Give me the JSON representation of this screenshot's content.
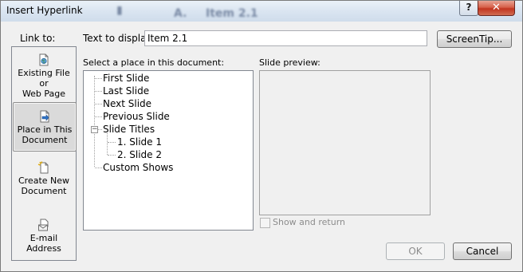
{
  "window": {
    "title": "Insert Hyperlink",
    "blurred_title_fragments": [
      "A.",
      "Item 2.1"
    ],
    "help_label": "?",
    "close_label": "✕"
  },
  "link_to": {
    "label": "Link to:",
    "items": [
      {
        "label_line1": "Existing File or",
        "label_line2": "Web Page",
        "icon": "existing-file-icon",
        "selected": false
      },
      {
        "label_line1": "Place in This",
        "label_line2": "Document",
        "icon": "place-in-document-icon",
        "selected": true
      },
      {
        "label_line1": "Create New",
        "label_line2": "Document",
        "icon": "new-document-icon",
        "selected": false
      },
      {
        "label_line1": "E-mail Address",
        "label_line2": "",
        "icon": "email-icon",
        "selected": false
      }
    ]
  },
  "text_to_display": {
    "label": "Text to display:",
    "value": "Item 2.1"
  },
  "screentip_button": "ScreenTip...",
  "place_list": {
    "label": "Select a place in this document:",
    "items": [
      {
        "text": "First Slide",
        "level": 0
      },
      {
        "text": "Last Slide",
        "level": 0
      },
      {
        "text": "Next Slide",
        "level": 0
      },
      {
        "text": "Previous Slide",
        "level": 0
      },
      {
        "text": "Slide Titles",
        "level": 0,
        "expanded": true,
        "expander": "−"
      },
      {
        "text": "1. Slide 1",
        "level": 1
      },
      {
        "text": "2. Slide 2",
        "level": 1
      },
      {
        "text": "Custom Shows",
        "level": 0
      }
    ]
  },
  "slide_preview": {
    "label": "Slide preview:"
  },
  "show_and_return": {
    "label": "Show and return",
    "checked": false,
    "enabled": false
  },
  "buttons": {
    "ok": "OK",
    "cancel": "Cancel"
  },
  "colors": {
    "dialog_bg": "#f0f0f0",
    "selected_bg": "#dadada",
    "close_red": "#c2351f"
  }
}
